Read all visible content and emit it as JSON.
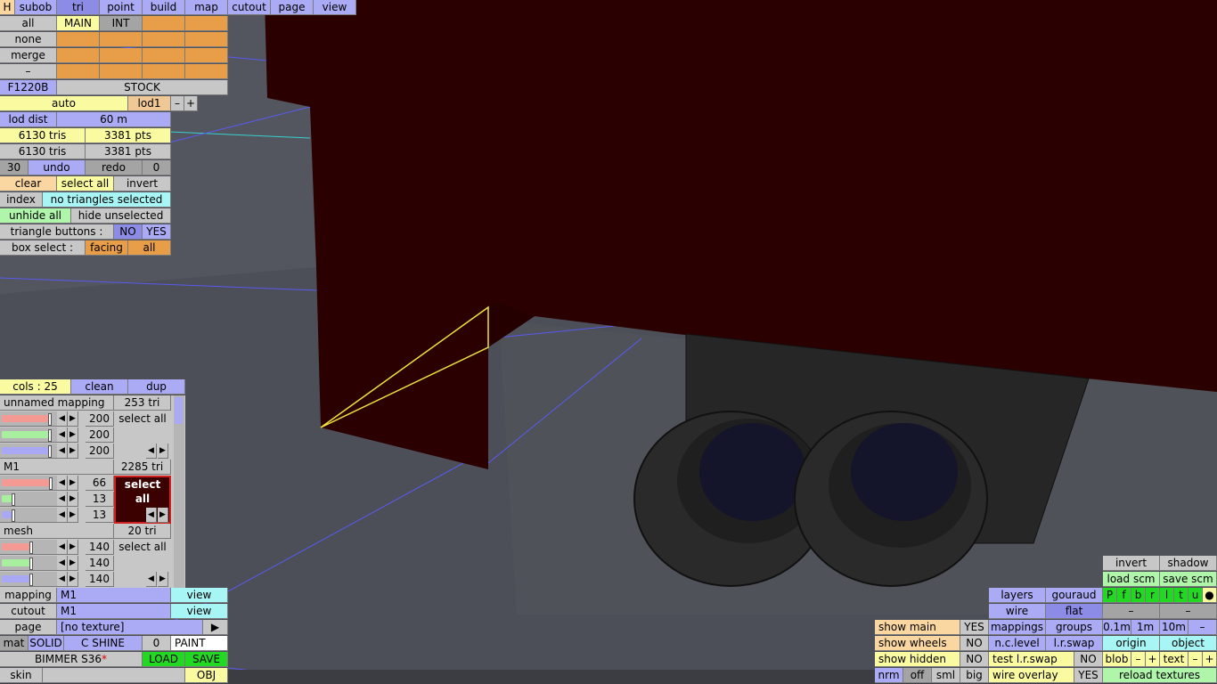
{
  "menu": {
    "h": "H",
    "items": [
      "subob",
      "tri",
      "point",
      "build",
      "map",
      "cutout",
      "page",
      "view"
    ]
  },
  "sel_side": [
    "all",
    "none",
    "merge",
    "–"
  ],
  "layers": {
    "main": "MAIN",
    "int": "INT"
  },
  "model": {
    "name": "F1220B",
    "variant": "STOCK"
  },
  "lod": {
    "auto": "auto",
    "lod": "lod1",
    "minus": "–",
    "plus": "+",
    "dist_label": "lod dist",
    "dist_value": "60 m"
  },
  "counts": {
    "tris1": "6130 tris",
    "pts1": "3381 pts",
    "tris2": "6130 tris",
    "pts2": "3381 pts"
  },
  "history": {
    "steps": "30",
    "undo": "undo",
    "redo": "redo",
    "count": "0"
  },
  "select": {
    "clear": "clear",
    "all": "select all",
    "invert": "invert"
  },
  "index": {
    "label": "index",
    "status": "no triangles selected"
  },
  "hide": {
    "unhide": "unhide all",
    "hide": "hide unselected"
  },
  "tri_buttons": {
    "label": "triangle buttons :",
    "no": "NO",
    "yes": "YES"
  },
  "box_select": {
    "label": "box select :",
    "facing": "facing",
    "all": "all"
  },
  "cols": {
    "label": "cols : 25",
    "clean": "clean",
    "dup": "dup"
  },
  "materials": [
    {
      "name": "unnamed mapping",
      "count": "253 tri",
      "values": [
        "200",
        "200",
        "200"
      ],
      "levels": [
        0.92,
        0.92,
        0.92
      ],
      "select": "select all",
      "active": false
    },
    {
      "name": "M1",
      "count": "2285 tri",
      "values": [
        "66",
        "13",
        "13"
      ],
      "levels": [
        0.94,
        0.2,
        0.2
      ],
      "select": "select all",
      "active": true
    },
    {
      "name": "mesh",
      "count": "20 tri",
      "values": [
        "140",
        "140",
        "140"
      ],
      "levels": [
        0.55,
        0.55,
        0.55
      ],
      "select": "select all",
      "active": false
    }
  ],
  "swatches": {
    "m1": "#3b0000"
  },
  "bottom": {
    "mapping_label": "mapping",
    "mapping_value": "M1",
    "mapping_view": "view",
    "cutout_label": "cutout",
    "cutout_value": "M1",
    "cutout_view": "view",
    "page_label": "page",
    "page_value": "[no texture]",
    "page_arrow": "▶",
    "mat": "mat",
    "solid": "SOLID",
    "cshine": "C SHINE",
    "zero": "0",
    "paint": "PAINT",
    "car": "BIMMER S36",
    "star": "*",
    "load": "LOAD",
    "save": "SAVE",
    "skin": "skin",
    "obj": "OBJ"
  },
  "right": {
    "invert": "invert",
    "shadow": "shadow",
    "load_scm": "load scm",
    "save_scm": "save scm",
    "layers": "layers",
    "gouraud": "gouraud",
    "wire": "wire",
    "flat": "flat",
    "letters": [
      "P",
      "f",
      "b",
      "r",
      "l",
      "t",
      "u",
      "●"
    ],
    "dash": "–",
    "show_main": "show main",
    "show_main_v": "YES",
    "mappings": "mappings",
    "groups": "groups",
    "grid": [
      "0.1m",
      "1m",
      "10m",
      "–"
    ],
    "show_wheels": "show wheels",
    "show_wheels_v": "NO",
    "nclevel": "n.c.level",
    "lrswap": "l.r.swap",
    "origin": "origin",
    "object": "object",
    "show_hidden": "show hidden",
    "show_hidden_v": "NO",
    "test_lr": "test l.r.swap",
    "test_lr_v": "NO",
    "blob": "blob",
    "text": "text",
    "plus": "+",
    "nrm": "nrm",
    "off": "off",
    "sml": "sml",
    "big": "big",
    "wire_overlay": "wire overlay",
    "wire_overlay_v": "YES",
    "reload": "reload textures"
  }
}
